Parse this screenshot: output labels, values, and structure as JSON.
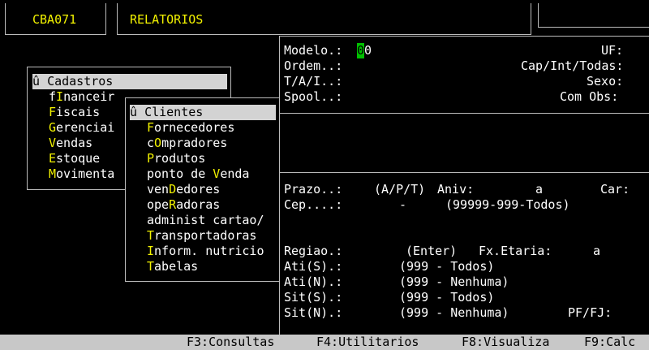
{
  "header": {
    "program_code": "CBA071",
    "title": "RELATORIOS"
  },
  "menu": {
    "bullet": "û",
    "items": [
      {
        "pre": " ",
        "hot": "C",
        "post": "adastros"
      },
      {
        "pre": "f",
        "hot": "I",
        "post": "nanceir"
      },
      {
        "pre": "",
        "hot": "F",
        "post": "iscais"
      },
      {
        "pre": "",
        "hot": "G",
        "post": "erenciai"
      },
      {
        "pre": "",
        "hot": "V",
        "post": "endas"
      },
      {
        "pre": "",
        "hot": "E",
        "post": "stoque"
      },
      {
        "pre": "",
        "hot": "M",
        "post": "ovimenta"
      }
    ]
  },
  "submenu": {
    "bullet": "û",
    "items": [
      {
        "pre": " ",
        "hot": "C",
        "post": "lientes"
      },
      {
        "pre": "",
        "hot": "F",
        "post": "ornecedores"
      },
      {
        "pre": "c",
        "hot": "O",
        "post": "mpradores"
      },
      {
        "pre": "",
        "hot": "P",
        "post": "rodutos"
      },
      {
        "pre": "ponto de ",
        "hot": "V",
        "post": "enda"
      },
      {
        "pre": "ven",
        "hot": "D",
        "post": "edores"
      },
      {
        "pre": "ope",
        "hot": "R",
        "post": "adoras"
      },
      {
        "pre": "administ cartao/",
        "hot": "",
        "post": ""
      },
      {
        "pre": "",
        "hot": "T",
        "post": "ransportadoras"
      },
      {
        "pre": "",
        "hot": "I",
        "post": "nform. nutricio"
      },
      {
        "pre": "",
        "hot": "T",
        "post": "abelas"
      }
    ]
  },
  "form": {
    "modelo_label": "Modelo.:",
    "modelo_cursor": "0",
    "modelo_value": "0",
    "ordem_label": "Ordem..:",
    "tai_label": "T/A/I..:",
    "spool_label": "Spool..:",
    "uf_label": "UF:",
    "cap_label": "Cap/Int/Todas:",
    "sexo_label": "Sexo:",
    "comobs_label": "Com Obs:",
    "prazo_label": "Prazo..:",
    "prazo_hint": "(A/P/T)",
    "aniv_label": "Aniv:",
    "aniv_sep": "a",
    "car_label": "Car:",
    "cep_label": "Cep....:",
    "cep_sep": "-",
    "cep_hint": "(99999-999-Todos)",
    "regiao_label": "Regiao.:",
    "regiao_hint": "(Enter)",
    "fxetaria_label": "Fx.Etaria:",
    "fxetaria_sep": "a",
    "atis_label": "Ati(S).:",
    "atis_hint": "(999 - Todos)",
    "atin_label": "Ati(N).:",
    "atin_hint": "(999 - Nenhuma)",
    "sits_label": "Sit(S).:",
    "sits_hint": "(999 - Todos)",
    "sitn_label": "Sit(N).:",
    "sitn_hint": "(999 - Nenhuma)",
    "pffj_label": "PF/FJ:"
  },
  "statusbar": {
    "f3": "F3:Consultas",
    "f4": "F4:Utilitarios",
    "f8": "F8:Visualiza",
    "f9": "F9:Calc"
  }
}
